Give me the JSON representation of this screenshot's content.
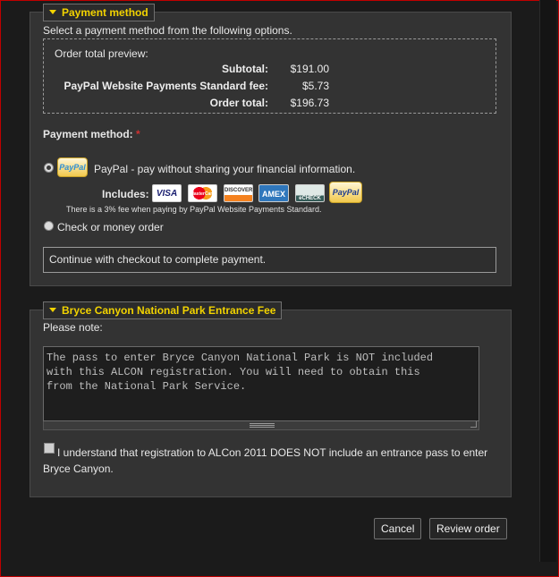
{
  "payment": {
    "legend": "Payment method",
    "intro": "Select a payment method from the following options.",
    "preview": {
      "title": "Order total preview:",
      "rows": [
        {
          "label": "Subtotal:",
          "value": "$191.00"
        },
        {
          "label": "PayPal Website Payments Standard fee:",
          "value": "$5.73"
        },
        {
          "label": "Order total:",
          "value": "$196.73"
        }
      ]
    },
    "method_label": "Payment method:",
    "required_mark": "*",
    "paypal_option": "PayPal - pay without sharing your financial information.",
    "paypal_badge": {
      "pay": "Pay",
      "pal": "Pal"
    },
    "includes_label": "Includes:",
    "cards": [
      "VISA",
      "MasterCard",
      "DISCOVER",
      "AMEX",
      "eCHECK",
      "PayPal"
    ],
    "fee_note": "There is a 3% fee when paying by PayPal Website Payments Standard.",
    "check_option": "Check or money order",
    "info": "Continue with checkout to complete payment.",
    "selected": "paypal"
  },
  "bryce": {
    "legend": "Bryce Canyon National Park Entrance Fee",
    "note_label": "Please note:",
    "textarea": "The pass to enter Bryce Canyon National Park is NOT included\nwith this ALCON registration. You will need to obtain this\nfrom the National Park Service.",
    "agree_text_1": "I understand that registration to ALCon 2011 DOES NOT include an entrance pass to enter",
    "agree_text_2": "Bryce Canyon.",
    "agree_checked": false
  },
  "buttons": {
    "cancel": "Cancel",
    "review": "Review order"
  },
  "colors": {
    "legend": "#f2d300",
    "required": "#d03030",
    "frame": "#c00000"
  }
}
